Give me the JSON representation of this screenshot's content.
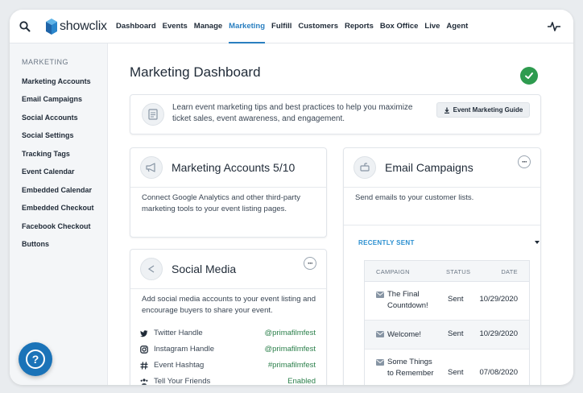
{
  "brand": {
    "name": "showclix",
    "accent": "#2a7fc0"
  },
  "nav": {
    "items": [
      "Dashboard",
      "Events",
      "Manage",
      "Marketing",
      "Fulfill",
      "Customers",
      "Reports",
      "Box Office",
      "Live",
      "Agent"
    ],
    "active": "Marketing"
  },
  "sidebar": {
    "heading": "MARKETING",
    "items": [
      "Marketing Accounts",
      "Email Campaigns",
      "Social Accounts",
      "Social Settings",
      "Tracking Tags",
      "Event Calendar",
      "Embedded Calendar",
      "Embedded Checkout",
      "Facebook Checkout",
      "Buttons"
    ]
  },
  "help": {
    "label": "?"
  },
  "page": {
    "title": "Marketing Dashboard"
  },
  "tips": {
    "text": "Learn event marketing tips and best practices to help you maximize ticket sales, event awareness, and engagement.",
    "button": "Event Marketing Guide"
  },
  "marketing_accounts": {
    "title": "Marketing Accounts 5/10",
    "description": "Connect Google Analytics and other third-party marketing tools to your event listing pages."
  },
  "social_media": {
    "title": "Social Media",
    "description": "Add social media accounts to your event listing and encourage buyers to share your event.",
    "rows": [
      {
        "icon": "twitter-icon",
        "label": "Twitter Handle",
        "value": "@primafilmfest"
      },
      {
        "icon": "instagram-icon",
        "label": "Instagram Handle",
        "value": "@primafilmfest"
      },
      {
        "icon": "hashtag-icon",
        "label": "Event Hashtag",
        "value": "#primafilmfest"
      },
      {
        "icon": "friends-icon",
        "label": "Tell Your Friends",
        "value": "Enabled"
      }
    ]
  },
  "email_campaigns": {
    "title": "Email Campaigns",
    "description": "Send emails to your customer lists.",
    "filter": "RECENTLY SENT",
    "columns": {
      "campaign": "CAMPAIGN",
      "status": "STATUS",
      "date": "DATE"
    },
    "rows": [
      {
        "campaign": "The Final Countdown!",
        "status": "Sent",
        "date": "10/29/2020"
      },
      {
        "campaign": "Welcome!",
        "status": "Sent",
        "date": "10/29/2020"
      },
      {
        "campaign": "Some Things to Remember",
        "status": "Sent",
        "date": "07/08/2020"
      }
    ]
  },
  "colors": {
    "success": "#2e9b4f",
    "help": "#1a73b8",
    "link": "#2a8fd0",
    "handle": "#2a7f4a"
  }
}
